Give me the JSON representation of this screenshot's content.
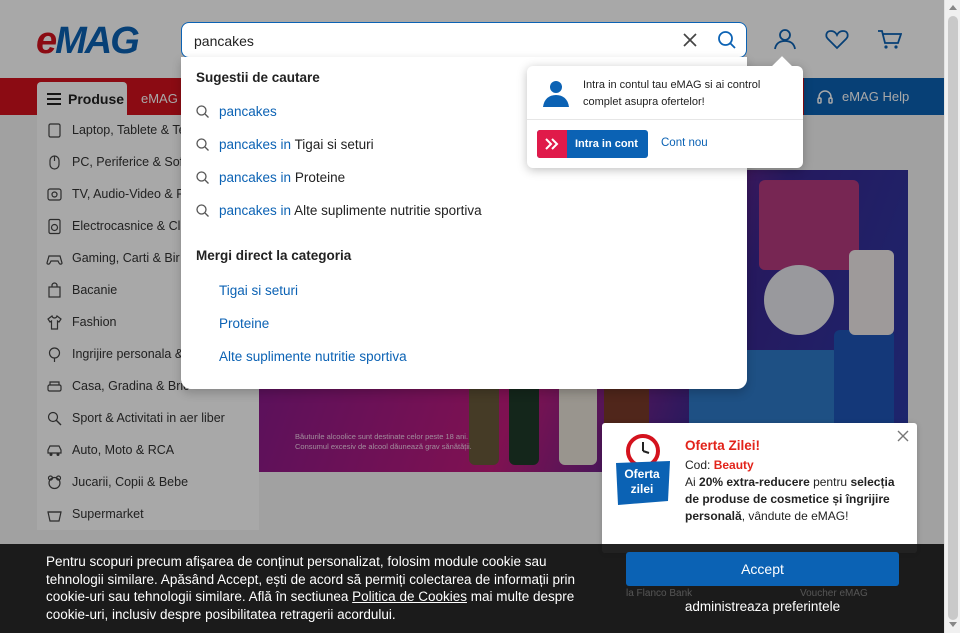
{
  "header": {
    "logo_text": "eMAG",
    "search": {
      "value": "pancakes",
      "placeholder": ""
    }
  },
  "navbar": {
    "produse_label": "Produse",
    "link_genius": "eMAG G",
    "help_label": "eMAG Help"
  },
  "sidebar": {
    "items": [
      {
        "label": "Laptop, Tablete & Te",
        "icon": "laptop-icon"
      },
      {
        "label": "PC, Periferice & Soft",
        "icon": "mouse-icon"
      },
      {
        "label": "TV, Audio-Video & F",
        "icon": "tv-icon"
      },
      {
        "label": "Electrocasnice & Cli",
        "icon": "washer-icon"
      },
      {
        "label": "Gaming, Carti & Bir",
        "icon": "gamepad-icon"
      },
      {
        "label": "Bacanie",
        "icon": "bag-icon"
      },
      {
        "label": "Fashion",
        "icon": "shirt-icon"
      },
      {
        "label": "Ingrijire personala &",
        "icon": "care-icon"
      },
      {
        "label": "Casa, Gradina & Bric",
        "icon": "sofa-icon"
      },
      {
        "label": "Sport & Activitati in aer liber",
        "icon": "sport-icon"
      },
      {
        "label": "Auto, Moto & RCA",
        "icon": "car-icon"
      },
      {
        "label": "Jucarii, Copii & Bebe",
        "icon": "toy-icon"
      },
      {
        "label": "Supermarket",
        "icon": "cart-icon"
      }
    ]
  },
  "banner": {
    "note": "Băuturile alcoolice sunt destinate celor peste 18 ani.\nConsumul excesiv de alcool dăunează grav sănătății."
  },
  "suggestions": {
    "title": "Sugestii de cautare",
    "rows": [
      {
        "keyword": "pancakes",
        "in": "",
        "category": ""
      },
      {
        "keyword": "pancakes",
        "in": " in ",
        "category": "Tigai si seturi"
      },
      {
        "keyword": "pancakes",
        "in": " in ",
        "category": "Proteine"
      },
      {
        "keyword": "pancakes",
        "in": " in ",
        "category": "Alte suplimente nutritie sportiva"
      }
    ],
    "direct_title": "Mergi direct la categoria",
    "direct": [
      "Tigai si seturi",
      "Proteine",
      "Alte suplimente nutritie sportiva"
    ]
  },
  "account_popup": {
    "message": "Intra in contul tau eMAG si ai control complet asupra ofertelor!",
    "login_label": "Intra in cont",
    "new_account_label": "Cont nou"
  },
  "offer": {
    "badge_text_1": "Oferta",
    "badge_text_2": "zilei",
    "title": "Oferta Zilei!",
    "code_label": "Cod: ",
    "code_value": "Beauty",
    "desc_1": "Ai ",
    "desc_bold_1": "20% extra-reducere",
    "desc_2": " pentru ",
    "desc_bold_2": "selecția de produse de cosmetice și îngrijire personală",
    "desc_3": ", vândute de eMAG!"
  },
  "cookie": {
    "text_1": "Pentru scopuri precum afișarea de conținut personalizat, folosim module cookie sau tehnologii similare. Apăsând Accept, ești de acord să permiți colectarea de informații prin cookie-uri sau tehnologii similare. Află în sectiunea ",
    "policy_link": "Politica de Cookies",
    "text_2": " mai multe despre cookie-uri, inclusiv despre posibilitatea retragerii acordului.",
    "accept_label": "Accept",
    "prefs_label": "administreaza preferintele",
    "ghost_1": "la Flanco Bank",
    "ghost_2": "Voucher eMAG"
  },
  "colors": {
    "emag_red": "#d4121d",
    "emag_blue": "#0b62b4",
    "offer_red": "#e2231a"
  }
}
